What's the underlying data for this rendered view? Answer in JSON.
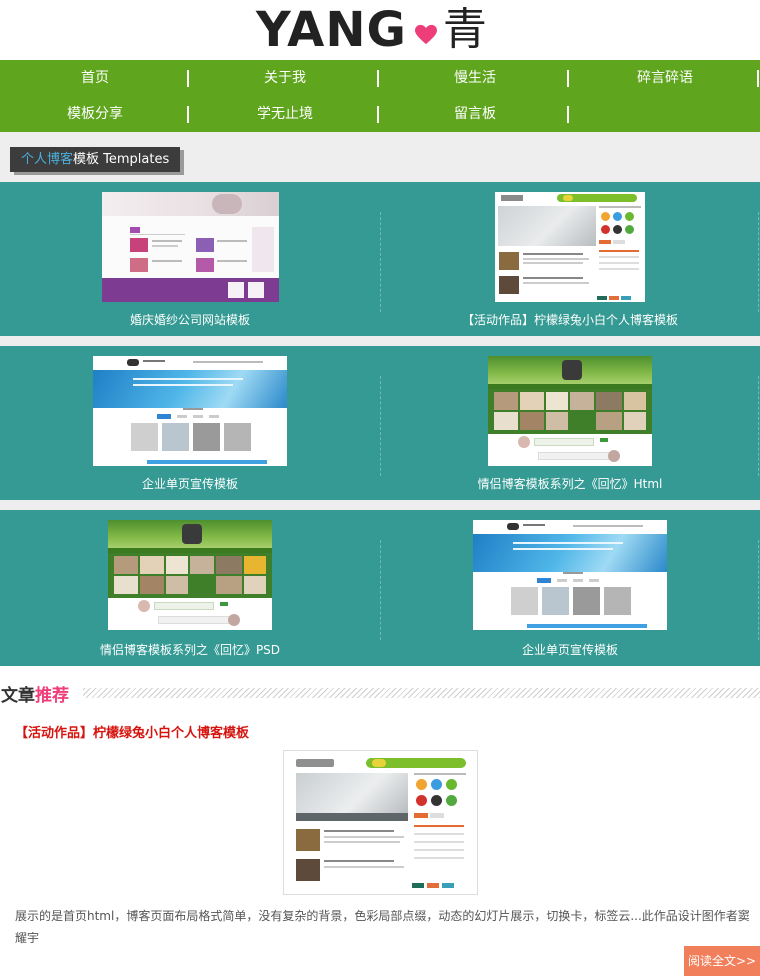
{
  "logo": {
    "word": "YANG",
    "cn": "青"
  },
  "nav": {
    "row1": [
      {
        "label": "首页"
      },
      {
        "label": "关于我"
      },
      {
        "label": "慢生活"
      },
      {
        "label": "碎言碎语"
      }
    ],
    "row2": [
      {
        "label": "模板分享"
      },
      {
        "label": "学无止境"
      },
      {
        "label": "留言板"
      }
    ]
  },
  "templates": {
    "heading_highlight": "个人博客",
    "heading_rest": "模板 Templates",
    "items": [
      {
        "caption": "婚庆婚纱公司网站模板"
      },
      {
        "caption": "【活动作品】柠檬绿兔小白个人博客模板"
      },
      {
        "caption": "企业单页宣传模板"
      },
      {
        "caption": "情侣博客模板系列之《回忆》Html"
      },
      {
        "caption": "情侣博客模板系列之《回忆》PSD"
      },
      {
        "caption": "企业单页宣传模板"
      }
    ]
  },
  "article": {
    "heading_a": "文章",
    "heading_b": "推荐",
    "title": "【活动作品】柠檬绿兔小白个人博客模板",
    "excerpt": "展示的是首页html，博客页面布局格式简单，没有复杂的背景，色彩局部点缀，动态的幻灯片展示，切换卡，标签云...此作品设计图作者窦耀宇",
    "read_more": "阅读全文>>"
  },
  "colors": {
    "nav_green": "#5fa51d",
    "teal": "#349a93",
    "heading_blue": "#4ab0dd",
    "pink": "#ee3e7a",
    "title_red": "#d6140f",
    "read_more_bg": "#f17f5b"
  }
}
